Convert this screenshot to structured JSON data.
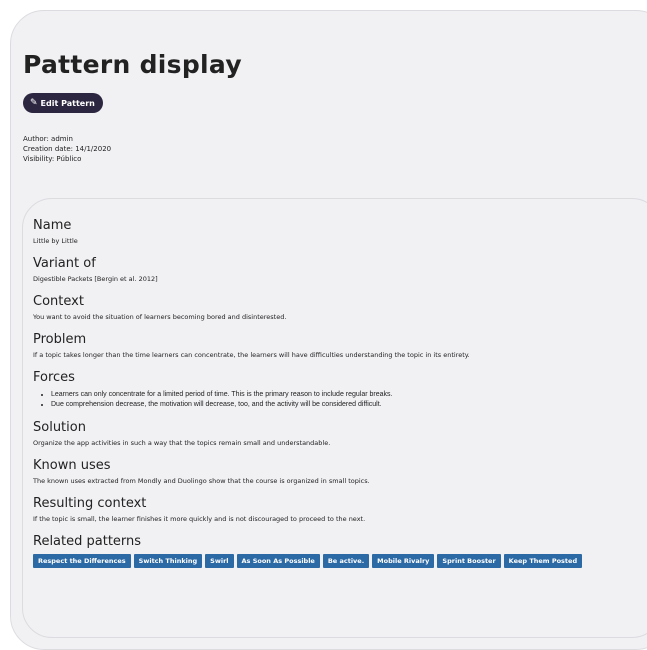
{
  "page": {
    "title": "Pattern display",
    "edit_label": "Edit Pattern",
    "edit_icon": "pencil-icon"
  },
  "meta": {
    "author": "Author: admin",
    "creation_date": "Creation date: 14/1/2020",
    "visibility": "Visibility: Público"
  },
  "sections": {
    "name": {
      "heading": "Name",
      "text": "Little by Little"
    },
    "variant": {
      "heading": "Variant of",
      "text": "Digestible Packets [Bergin et al. 2012]"
    },
    "context": {
      "heading": "Context",
      "text": "You want to avoid the situation of learners becoming bored and disinterested."
    },
    "problem": {
      "heading": "Problem",
      "text": "If a topic takes longer than the time learners can concentrate, the learners will have difficulties understanding the topic in its entirety."
    },
    "forces": {
      "heading": "Forces",
      "items": [
        "Learners can only concentrate for a limited period of time. This is the primary reason to include regular breaks.",
        "Due comprehension decrease, the motivation will decrease, too, and the activity will be considered difficult."
      ]
    },
    "solution": {
      "heading": "Solution",
      "text": "Organize the app activities in such a way that the topics remain small and understandable."
    },
    "known_uses": {
      "heading": "Known uses",
      "text": "The known uses extracted from Mondly and Duolingo show that the course is organized in small topics."
    },
    "resulting_context": {
      "heading": "Resulting context",
      "text": "If the topic is small, the learner finishes it more quickly and is not discouraged to proceed to the next."
    },
    "related": {
      "heading": "Related patterns",
      "items": [
        "Respect the Differences",
        "Switch Thinking",
        "Swirl",
        "As Soon As Possible",
        "Be active.",
        "Mobile Rivalry",
        "Sprint Booster",
        "Keep Them Posted"
      ]
    }
  },
  "colors": {
    "accent_dark": "#2c2640",
    "pattern_button": "#2c6aa6",
    "card_bg": "#f1f0f3"
  }
}
